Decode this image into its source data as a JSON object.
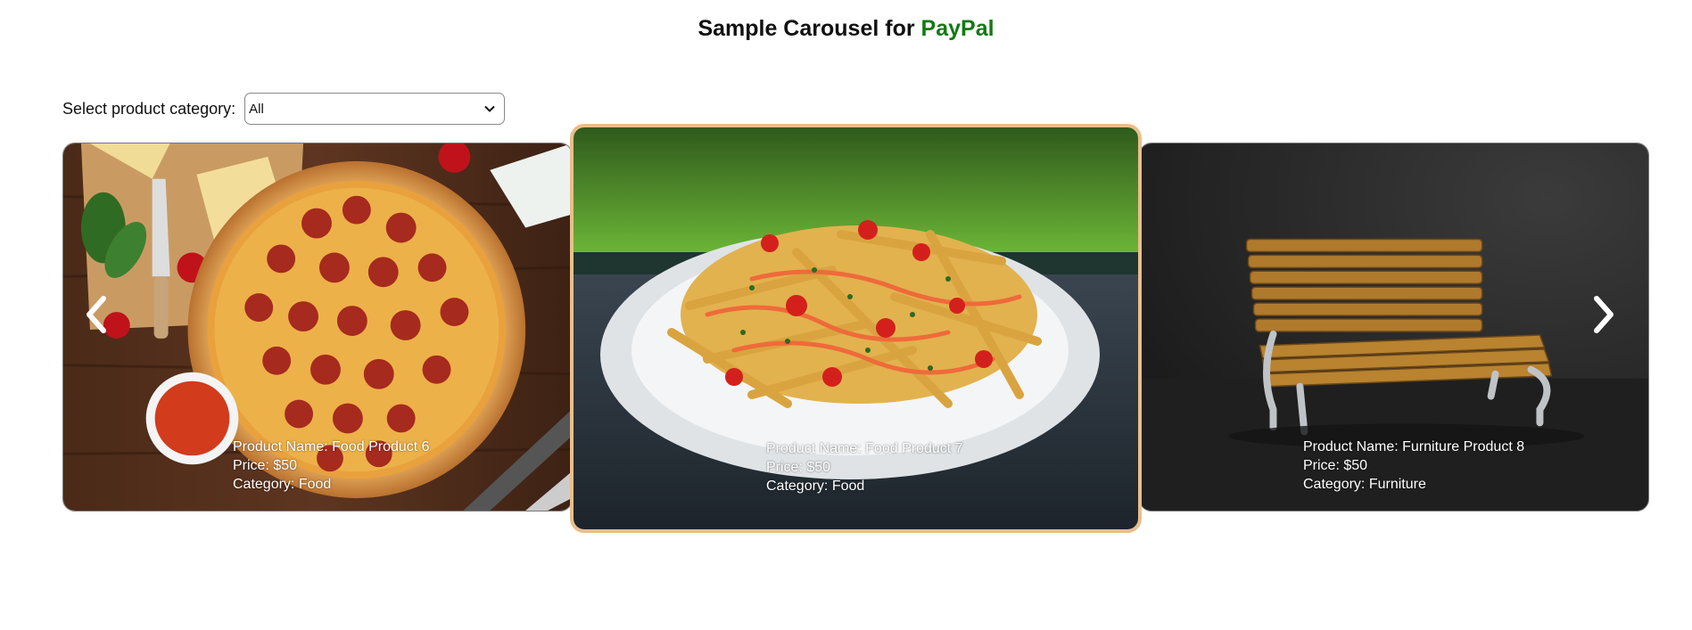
{
  "header": {
    "title_prefix": "Sample Carousel for",
    "title_brand": "PayPal",
    "brand_color": "#137a13"
  },
  "filter": {
    "label": "Select product category:",
    "selected": "All"
  },
  "carousel": {
    "prev_icon": "chevron-left-icon",
    "next_icon": "chevron-right-icon",
    "active_border_color": "#e8bf8a",
    "items": [
      {
        "name_line": "Product Name: Food Product 6",
        "price_line": "Price: $50",
        "category_line": "Category: Food",
        "image": "pepperoni-pizza"
      },
      {
        "name_line": "Product Name: Food Product 7",
        "price_line": "Price: $50",
        "category_line": "Category: Food",
        "image": "loaded-fries"
      },
      {
        "name_line": "Product Name: Furniture Product 8",
        "price_line": "Price: $50",
        "category_line": "Category: Furniture",
        "image": "wooden-bench"
      }
    ]
  }
}
